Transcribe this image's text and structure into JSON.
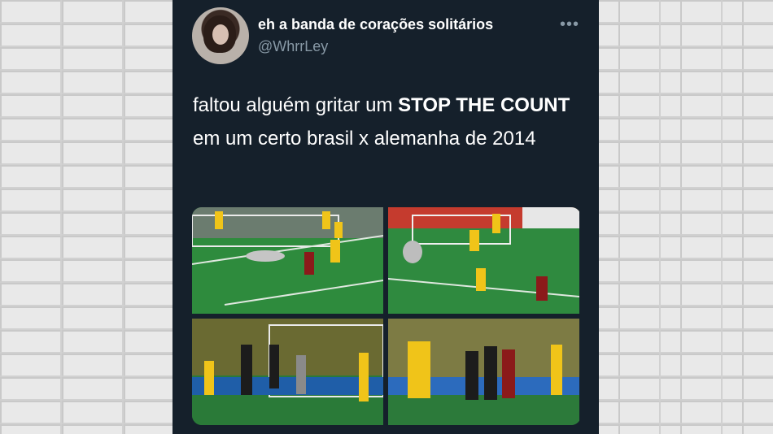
{
  "tweet": {
    "display_name": "eh a banda de corações solitários",
    "handle": "@WhrrLey",
    "more_icon": "more-horizontal-icon",
    "text_part1": "faltou alguém gritar um ",
    "text_bold": "STOP THE COUNT",
    "text_part2": " em um certo brasil x alemanha de 2014",
    "media": [
      {
        "name": "photo-goal-1"
      },
      {
        "name": "photo-goal-2"
      },
      {
        "name": "photo-goal-3"
      },
      {
        "name": "photo-goal-4"
      }
    ]
  },
  "colors": {
    "tweet_background": "#15202b",
    "muted_text": "#8899a6",
    "brazil_yellow": "#f0c419",
    "germany_red": "#8b1a1a"
  }
}
